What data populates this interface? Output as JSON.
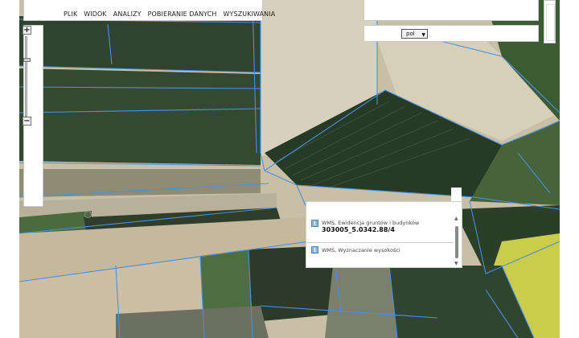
{
  "menu": {
    "items": [
      {
        "label": "PLIK"
      },
      {
        "label": "WIDOK"
      },
      {
        "label": "ANALIZY"
      },
      {
        "label": "POBIERANIE DANYCH"
      },
      {
        "label": "WYSZUKIWANIA"
      }
    ]
  },
  "zoom": {
    "in_label": "+",
    "out_label": "−"
  },
  "language": {
    "selected": "pol"
  },
  "popup": {
    "rows": [
      {
        "layer": "WMS, Ewidencja gruntów i budynków",
        "value": "303005_5.0342.88/4"
      },
      {
        "layer": "WMS, Wyznaczanie wysokości",
        "value": ""
      }
    ],
    "icon_glyph": "i"
  },
  "colors": {
    "parcel_boundary": "#4a90e2",
    "dark_field": "#2e3f2c",
    "light_field": "#cdc2a8",
    "rapeseed_field": "#d6d84a"
  }
}
